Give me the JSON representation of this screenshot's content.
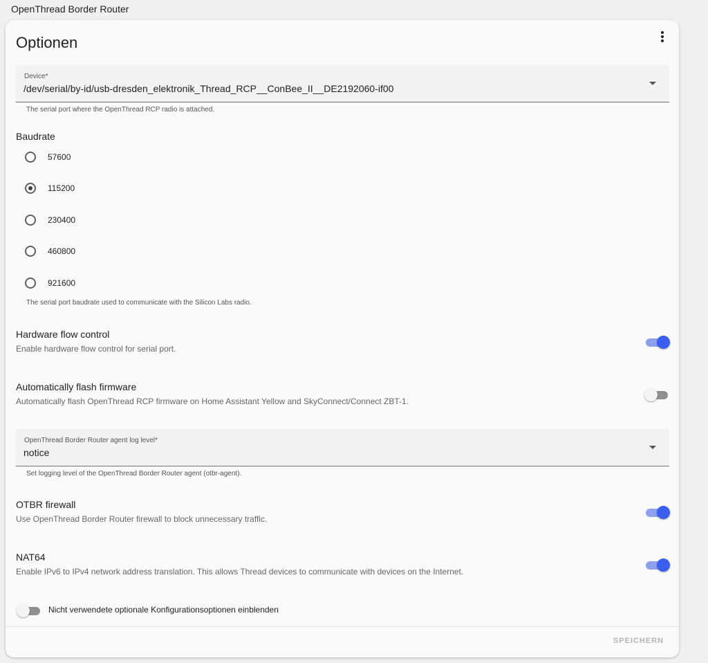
{
  "app": {
    "title": "OpenThread Border Router"
  },
  "card": {
    "title": "Optionen",
    "device": {
      "label": "Device*",
      "value": "/dev/serial/by-id/usb-dresden_elektronik_Thread_RCP__ConBee_II__DE2192060-if00",
      "helper": "The serial port where the OpenThread RCP radio is attached."
    },
    "baudrate": {
      "label": "Baudrate",
      "options": [
        "57600",
        "115200",
        "230400",
        "460800",
        "921600"
      ],
      "selected": "115200",
      "helper": "The serial port baudrate used to communicate with the Silicon Labs radio."
    },
    "flow_control": {
      "title": "Hardware flow control",
      "description": "Enable hardware flow control for serial port.",
      "enabled": true
    },
    "auto_flash": {
      "title": "Automatically flash firmware",
      "description": "Automatically flash OpenThread RCP firmware on Home Assistant Yellow and SkyConnect/Connect ZBT-1.",
      "enabled": false
    },
    "log_level": {
      "label": "OpenThread Border Router agent log level*",
      "value": "notice",
      "helper": "Set logging level of the OpenThread Border Router agent (otbr-agent)."
    },
    "firewall": {
      "title": "OTBR firewall",
      "description": "Use OpenThread Border Router firewall to block unnecessary traffic.",
      "enabled": true
    },
    "nat64": {
      "title": "NAT64",
      "description": "Enable IPv6 to IPv4 network address translation. This allows Thread devices to communicate with devices on the Internet.",
      "enabled": true
    },
    "show_unused": {
      "label": "Nicht verwendete optionale Konfigurationsoptionen einblenden",
      "enabled": false
    },
    "save_label": "SPEICHERN"
  },
  "colors": {
    "accent": "#3b5ef0",
    "accent_track": "#8ca0ee",
    "page_bg": "#f0f0f0",
    "card_bg": "#fafafa"
  }
}
